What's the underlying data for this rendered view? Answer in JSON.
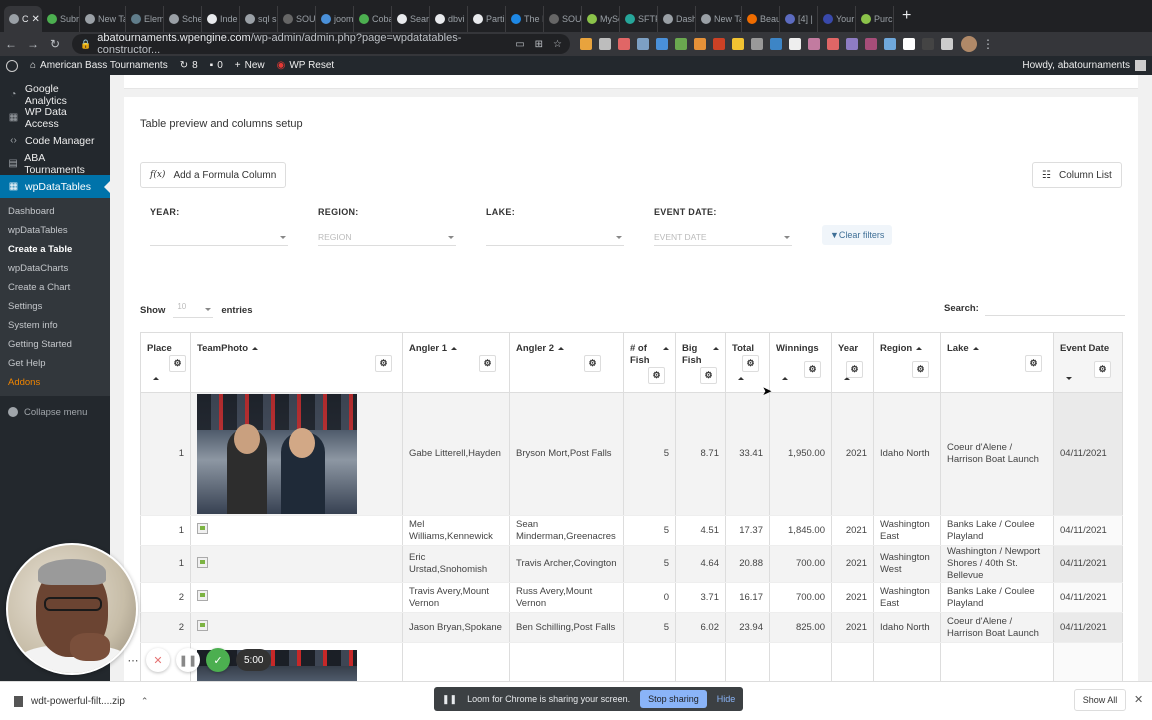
{
  "browser": {
    "tabs": [
      {
        "label": "C"
      },
      {
        "label": "Subr"
      },
      {
        "label": "New Tab"
      },
      {
        "label": "Elem"
      },
      {
        "label": "Sche"
      },
      {
        "label": "Inde"
      },
      {
        "label": "sql s"
      },
      {
        "label": "SOU"
      },
      {
        "label": "joom"
      },
      {
        "label": "Coba"
      },
      {
        "label": "Sear"
      },
      {
        "label": "dbvi"
      },
      {
        "label": "Parti"
      },
      {
        "label": "The I"
      },
      {
        "label": "SOU"
      },
      {
        "label": "MySc"
      },
      {
        "label": "SFTP"
      },
      {
        "label": "Dash"
      },
      {
        "label": "New Tab"
      },
      {
        "label": "Beau"
      },
      {
        "label": "[4] |"
      },
      {
        "label": "Your"
      },
      {
        "label": "Purc"
      }
    ],
    "url_host": "abatournaments.wpengine.com",
    "url_path": "/wp-admin/admin.php?page=wpdatatables-constructor..."
  },
  "adminbar": {
    "site_name": "American Bass Tournaments",
    "updates_count": "8",
    "comments_count": "0",
    "new_label": "New",
    "wp_reset_label": "WP Reset",
    "howdy": "Howdy, abatournaments"
  },
  "sidebar": {
    "items": [
      {
        "label": "Google Analytics",
        "icon": "◔"
      },
      {
        "label": "WP Data Access",
        "icon": "▦"
      },
      {
        "label": "Code Manager",
        "icon": "‹›"
      },
      {
        "label": "ABA Tournaments",
        "icon": "▤"
      },
      {
        "label": "wpDataTables",
        "icon": "▦"
      }
    ],
    "submenu": [
      "Dashboard",
      "wpDataTables",
      "Create a Table",
      "wpDataCharts",
      "Create a Chart",
      "Settings",
      "System info",
      "Getting Started",
      "Get Help",
      "Addons"
    ],
    "collapse_label": "Collapse menu"
  },
  "panel": {
    "title": "Table preview and columns setup",
    "formula_button": "Add a Formula Column",
    "formula_icon": "f(x)",
    "column_list_button": "Column List"
  },
  "filters": [
    {
      "label": "YEAR:",
      "placeholder": ""
    },
    {
      "label": "REGION:",
      "placeholder": "REGION"
    },
    {
      "label": "LAKE:",
      "placeholder": ""
    },
    {
      "label": "EVENT DATE:",
      "placeholder": "EVENT DATE"
    }
  ],
  "clear_filters": "Clear filters",
  "show_entries": {
    "show": "Show",
    "value": "10",
    "entries": "entries"
  },
  "search_label": "Search:",
  "table": {
    "headers": [
      "Place",
      "TeamPhoto",
      "Angler 1",
      "Angler 2",
      "# of Fish",
      "Big Fish",
      "Total",
      "Winnings",
      "Year",
      "Region",
      "Lake",
      "Event Date"
    ],
    "rows": [
      {
        "place": "1",
        "angler1": "Gabe Litterell,Hayden",
        "angler2": "Bryson Mort,Post Falls",
        "fish": "5",
        "big": "8.71",
        "total": "33.41",
        "win": "1,950.00",
        "year": "2021",
        "region": "Idaho North",
        "lake": "Coeur d'Alene / Harrison Boat Launch",
        "date": "04/11/2021"
      },
      {
        "place": "1",
        "angler1": "Mel Williams,Kennewick",
        "angler2": "Sean Minderman,Greenacres",
        "fish": "5",
        "big": "4.51",
        "total": "17.37",
        "win": "1,845.00",
        "year": "2021",
        "region": "Washington East",
        "lake": "Banks Lake / Coulee Playland",
        "date": "04/11/2021"
      },
      {
        "place": "1",
        "angler1": "Eric Urstad,Snohomish",
        "angler2": "Travis Archer,Covington",
        "fish": "5",
        "big": "4.64",
        "total": "20.88",
        "win": "700.00",
        "year": "2021",
        "region": "Washington West",
        "lake": "Washington / Newport Shores / 40th St. Bellevue",
        "date": "04/11/2021"
      },
      {
        "place": "2",
        "angler1": "Travis Avery,Mount Vernon",
        "angler2": "Russ Avery,Mount Vernon",
        "fish": "0",
        "big": "3.71",
        "total": "16.17",
        "win": "700.00",
        "year": "2021",
        "region": "Washington East",
        "lake": "Banks Lake / Coulee Playland",
        "date": "04/11/2021"
      },
      {
        "place": "2",
        "angler1": "Jason Bryan,Spokane",
        "angler2": "Ben Schilling,Post Falls",
        "fish": "5",
        "big": "6.02",
        "total": "23.94",
        "win": "825.00",
        "year": "2021",
        "region": "Idaho North",
        "lake": "Coeur d'Alene / Harrison Boat Launch",
        "date": "04/11/2021"
      }
    ]
  },
  "recorder": {
    "timer": "5:00"
  },
  "downloads": {
    "file_name": "wdt-powerful-filt....zip",
    "show_all": "Show All"
  },
  "sharing": {
    "message": "Loom for Chrome is sharing your screen.",
    "stop": "Stop sharing",
    "hide": "Hide"
  }
}
